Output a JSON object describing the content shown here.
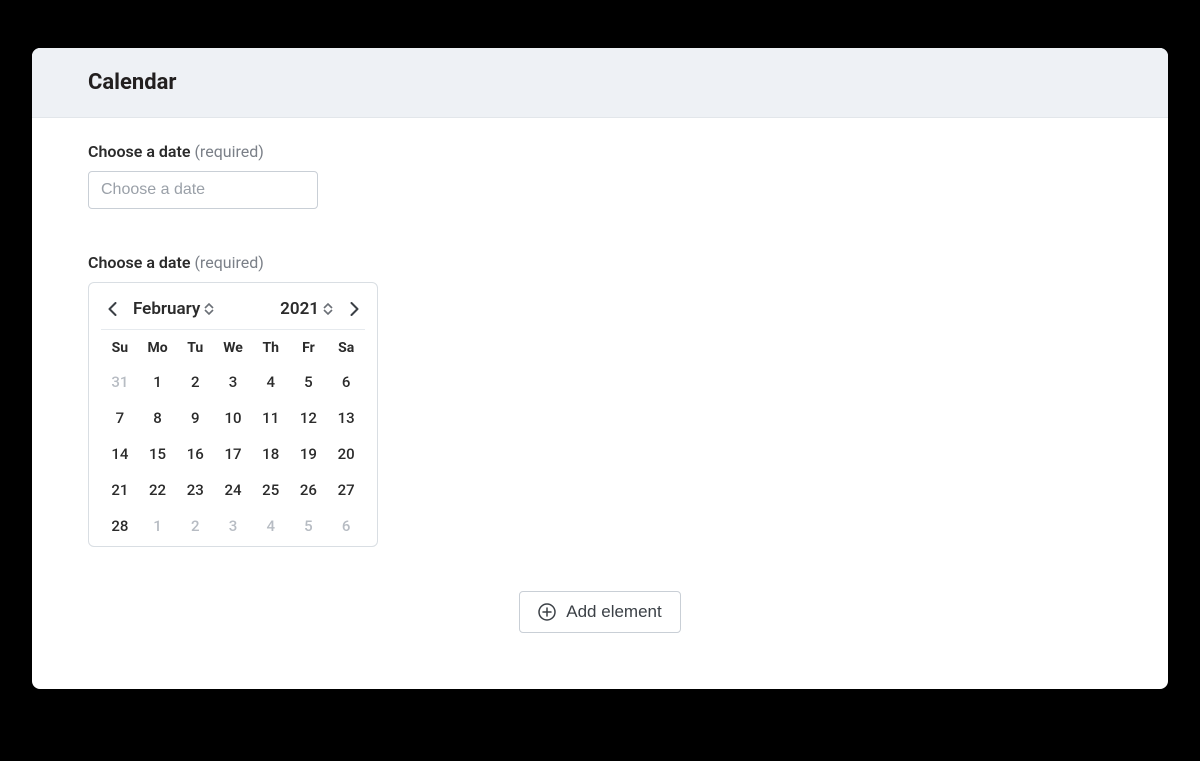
{
  "header": {
    "title": "Calendar"
  },
  "fields": {
    "label_text": "Choose a date",
    "required_text": "(required)",
    "date_input": {
      "placeholder": "Choose a date",
      "value": ""
    }
  },
  "calendar": {
    "month": "February",
    "year": "2021",
    "dow": [
      "Su",
      "Mo",
      "Tu",
      "We",
      "Th",
      "Fr",
      "Sa"
    ],
    "grid": [
      {
        "d": "31",
        "muted": true
      },
      {
        "d": "1"
      },
      {
        "d": "2"
      },
      {
        "d": "3"
      },
      {
        "d": "4"
      },
      {
        "d": "5"
      },
      {
        "d": "6"
      },
      {
        "d": "7"
      },
      {
        "d": "8"
      },
      {
        "d": "9"
      },
      {
        "d": "10"
      },
      {
        "d": "11"
      },
      {
        "d": "12"
      },
      {
        "d": "13"
      },
      {
        "d": "14"
      },
      {
        "d": "15"
      },
      {
        "d": "16"
      },
      {
        "d": "17"
      },
      {
        "d": "18"
      },
      {
        "d": "19"
      },
      {
        "d": "20"
      },
      {
        "d": "21"
      },
      {
        "d": "22"
      },
      {
        "d": "23"
      },
      {
        "d": "24"
      },
      {
        "d": "25"
      },
      {
        "d": "26"
      },
      {
        "d": "27"
      },
      {
        "d": "28"
      },
      {
        "d": "1",
        "muted": true
      },
      {
        "d": "2",
        "muted": true
      },
      {
        "d": "3",
        "muted": true
      },
      {
        "d": "4",
        "muted": true
      },
      {
        "d": "5",
        "muted": true
      },
      {
        "d": "6",
        "muted": true
      }
    ]
  },
  "footer": {
    "add_label": "Add element"
  }
}
